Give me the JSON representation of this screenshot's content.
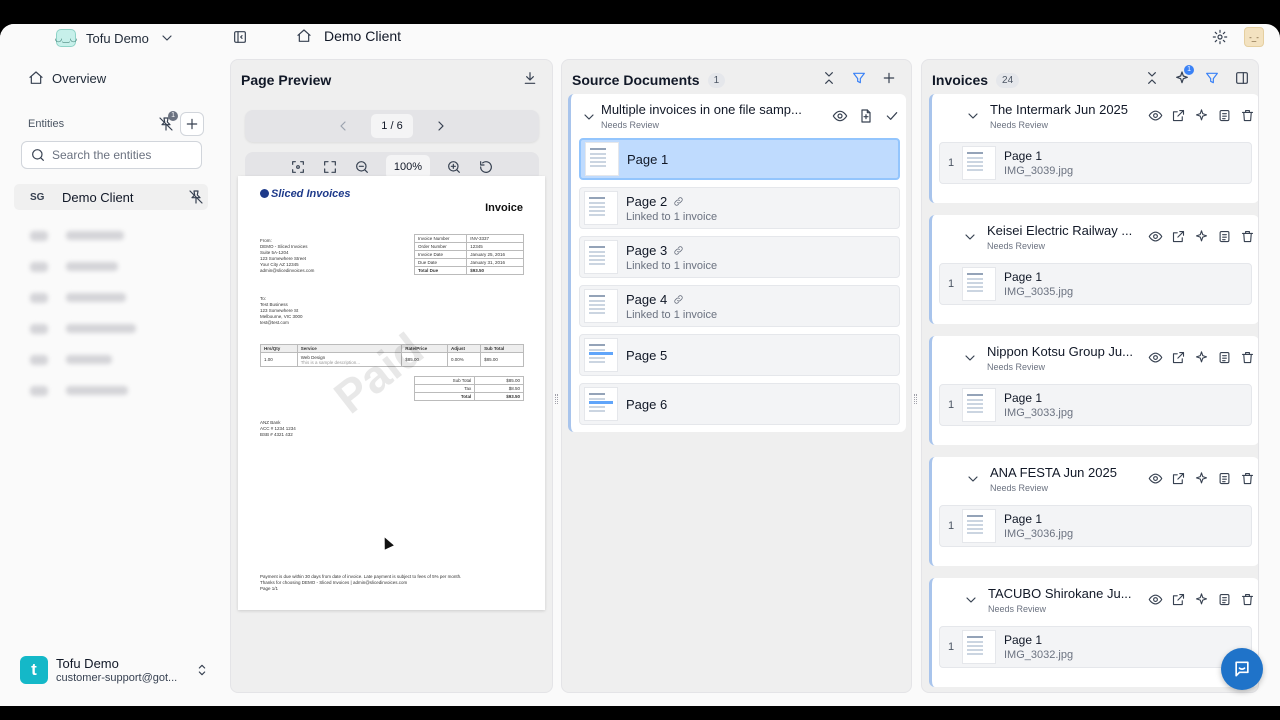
{
  "sidebar": {
    "workspace_name": "Tofu Demo",
    "workspace_logo": "tofu-face",
    "overview_label": "Overview",
    "entities_label": "Entities",
    "pin_badge": "1",
    "search_placeholder": "Search the entities",
    "active_entity": {
      "code": "SG",
      "name": "Demo Client"
    },
    "blurred_entity_count": 6,
    "user": {
      "initial": "t",
      "name": "Tofu Demo",
      "email": "customer-support@got..."
    }
  },
  "topbar": {
    "breadcrumb": "Demo Client"
  },
  "preview": {
    "title": "Page Preview",
    "page_indicator": "1 / 6",
    "zoom": "100%",
    "doc": {
      "brand": "Sliced Invoices",
      "heading": "Invoice",
      "watermark": "Paid",
      "from_lines": "From:\nDEMO - Sliced Invoices\nSuite 5A-1204\n123 Somewhere Street\nYour City AZ 12345\nadmin@slicedinvoices.com",
      "to_lines": "To:\nTest Business\n123 Somewhere St\nMelbourne, VIC 3000\ntest@test.com",
      "meta": [
        [
          "Invoice Number",
          "INV-3337"
        ],
        [
          "Order Number",
          "12345"
        ],
        [
          "Invoice Date",
          "January 25, 2016"
        ],
        [
          "Due Date",
          "January 31, 2016"
        ],
        [
          "Total Due",
          "$93.50"
        ]
      ],
      "items_header": [
        "Hrs/Qty",
        "Service",
        "Rate/Price",
        "Adjust",
        "Sub Total"
      ],
      "items": [
        [
          "1.00",
          "Web Design",
          "$85.00",
          "0.00%",
          "$85.00"
        ]
      ],
      "item_note": "This is a sample description...",
      "totals": [
        [
          "Sub Total",
          "$85.00"
        ],
        [
          "Tax",
          "$8.50"
        ],
        [
          "Total",
          "$93.50"
        ]
      ],
      "bank_lines": "ANZ Bank\nACC # 1234 1234\nBSB # 4321 432",
      "footer_lines": "Payment is due within 30 days from date of invoice. Late payment is subject to fees of 5% per month.\nThanks for choosing DEMO - Sliced Invoices | admin@slicedinvoices.com\nPage 1/1"
    }
  },
  "source": {
    "title": "Source Documents",
    "count": "1",
    "file_name": "Multiple invoices in one file samp...",
    "file_status": "Needs Review",
    "pages": [
      {
        "label": "Page 1",
        "sub": "",
        "linked": false,
        "selected": true
      },
      {
        "label": "Page 2",
        "sub": "Linked to 1 invoice",
        "linked": true,
        "selected": false
      },
      {
        "label": "Page 3",
        "sub": "Linked to 1 invoice",
        "linked": true,
        "selected": false
      },
      {
        "label": "Page 4",
        "sub": "Linked to 1 invoice",
        "linked": true,
        "selected": false
      },
      {
        "label": "Page 5",
        "sub": "",
        "linked": false,
        "selected": false
      },
      {
        "label": "Page 6",
        "sub": "",
        "linked": false,
        "selected": false
      }
    ]
  },
  "invoices": {
    "title": "Invoices",
    "count": "24",
    "ai_badge": "1",
    "items": [
      {
        "name": "The Intermark Jun 2025",
        "status": "Needs Review",
        "page_num": "1",
        "page_label": "Page 1",
        "file": "IMG_3039.jpg"
      },
      {
        "name": "Keisei Electric Railway ...",
        "status": "Needs Review",
        "page_num": "1",
        "page_label": "Page 1",
        "file": "IMG_3035.jpg"
      },
      {
        "name": "Nippon Kotsu Group Ju...",
        "status": "Needs Review",
        "page_num": "1",
        "page_label": "Page 1",
        "file": "IMG_3033.jpg"
      },
      {
        "name": "ANA FESTA Jun 2025",
        "status": "Needs Review",
        "page_num": "1",
        "page_label": "Page 1",
        "file": "IMG_3036.jpg"
      },
      {
        "name": "TACUBO Shirokane Ju...",
        "status": "Needs Review",
        "page_num": "1",
        "page_label": "Page 1",
        "file": "IMG_3032.jpg"
      }
    ]
  },
  "colors": {
    "accent": "#3b82f6",
    "selected_row": "#bfdbfe",
    "card_border": "#a8c4ec",
    "chat": "#1f73c9"
  }
}
